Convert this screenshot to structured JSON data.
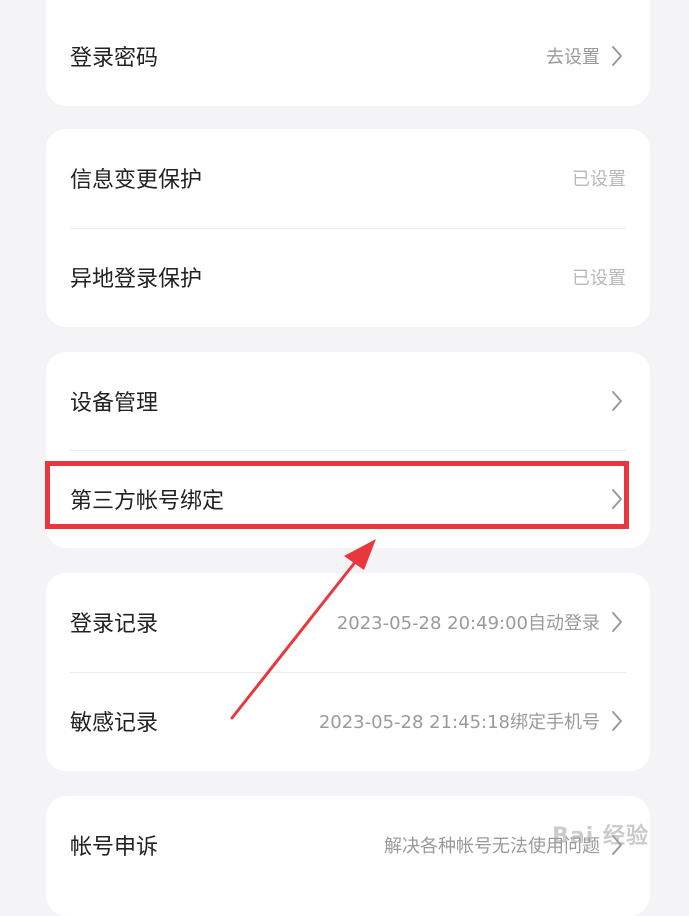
{
  "colors": {
    "background": "#f4f4f6",
    "card": "#ffffff",
    "label_text": "#222222",
    "value_text": "#9a9a9a",
    "highlight": "#e8383d"
  },
  "sections": [
    {
      "rows": [
        {
          "label": "登录密码",
          "value": "去设置",
          "chevron": "chevron-right-icon"
        }
      ]
    },
    {
      "rows": [
        {
          "label": "信息变更保护",
          "value": "已设置"
        },
        {
          "label": "异地登录保护",
          "value": "已设置"
        }
      ]
    },
    {
      "rows": [
        {
          "label": "设备管理",
          "value": "",
          "chevron": "chevron-right-icon"
        },
        {
          "label": "第三方帐号绑定",
          "value": "",
          "chevron": "chevron-right-icon"
        }
      ]
    },
    {
      "rows": [
        {
          "label": "登录记录",
          "value": "2023-05-28 20:49:00自动登录",
          "chevron": "chevron-right-icon"
        },
        {
          "label": "敏感记录",
          "value": "2023-05-28 21:45:18绑定手机号",
          "chevron": "chevron-right-icon"
        }
      ]
    },
    {
      "rows": [
        {
          "label": "帐号申诉",
          "value": "解决各种帐号无法使用问题",
          "chevron": "chevron-right-icon"
        }
      ]
    }
  ],
  "watermark": "Bai 经验"
}
